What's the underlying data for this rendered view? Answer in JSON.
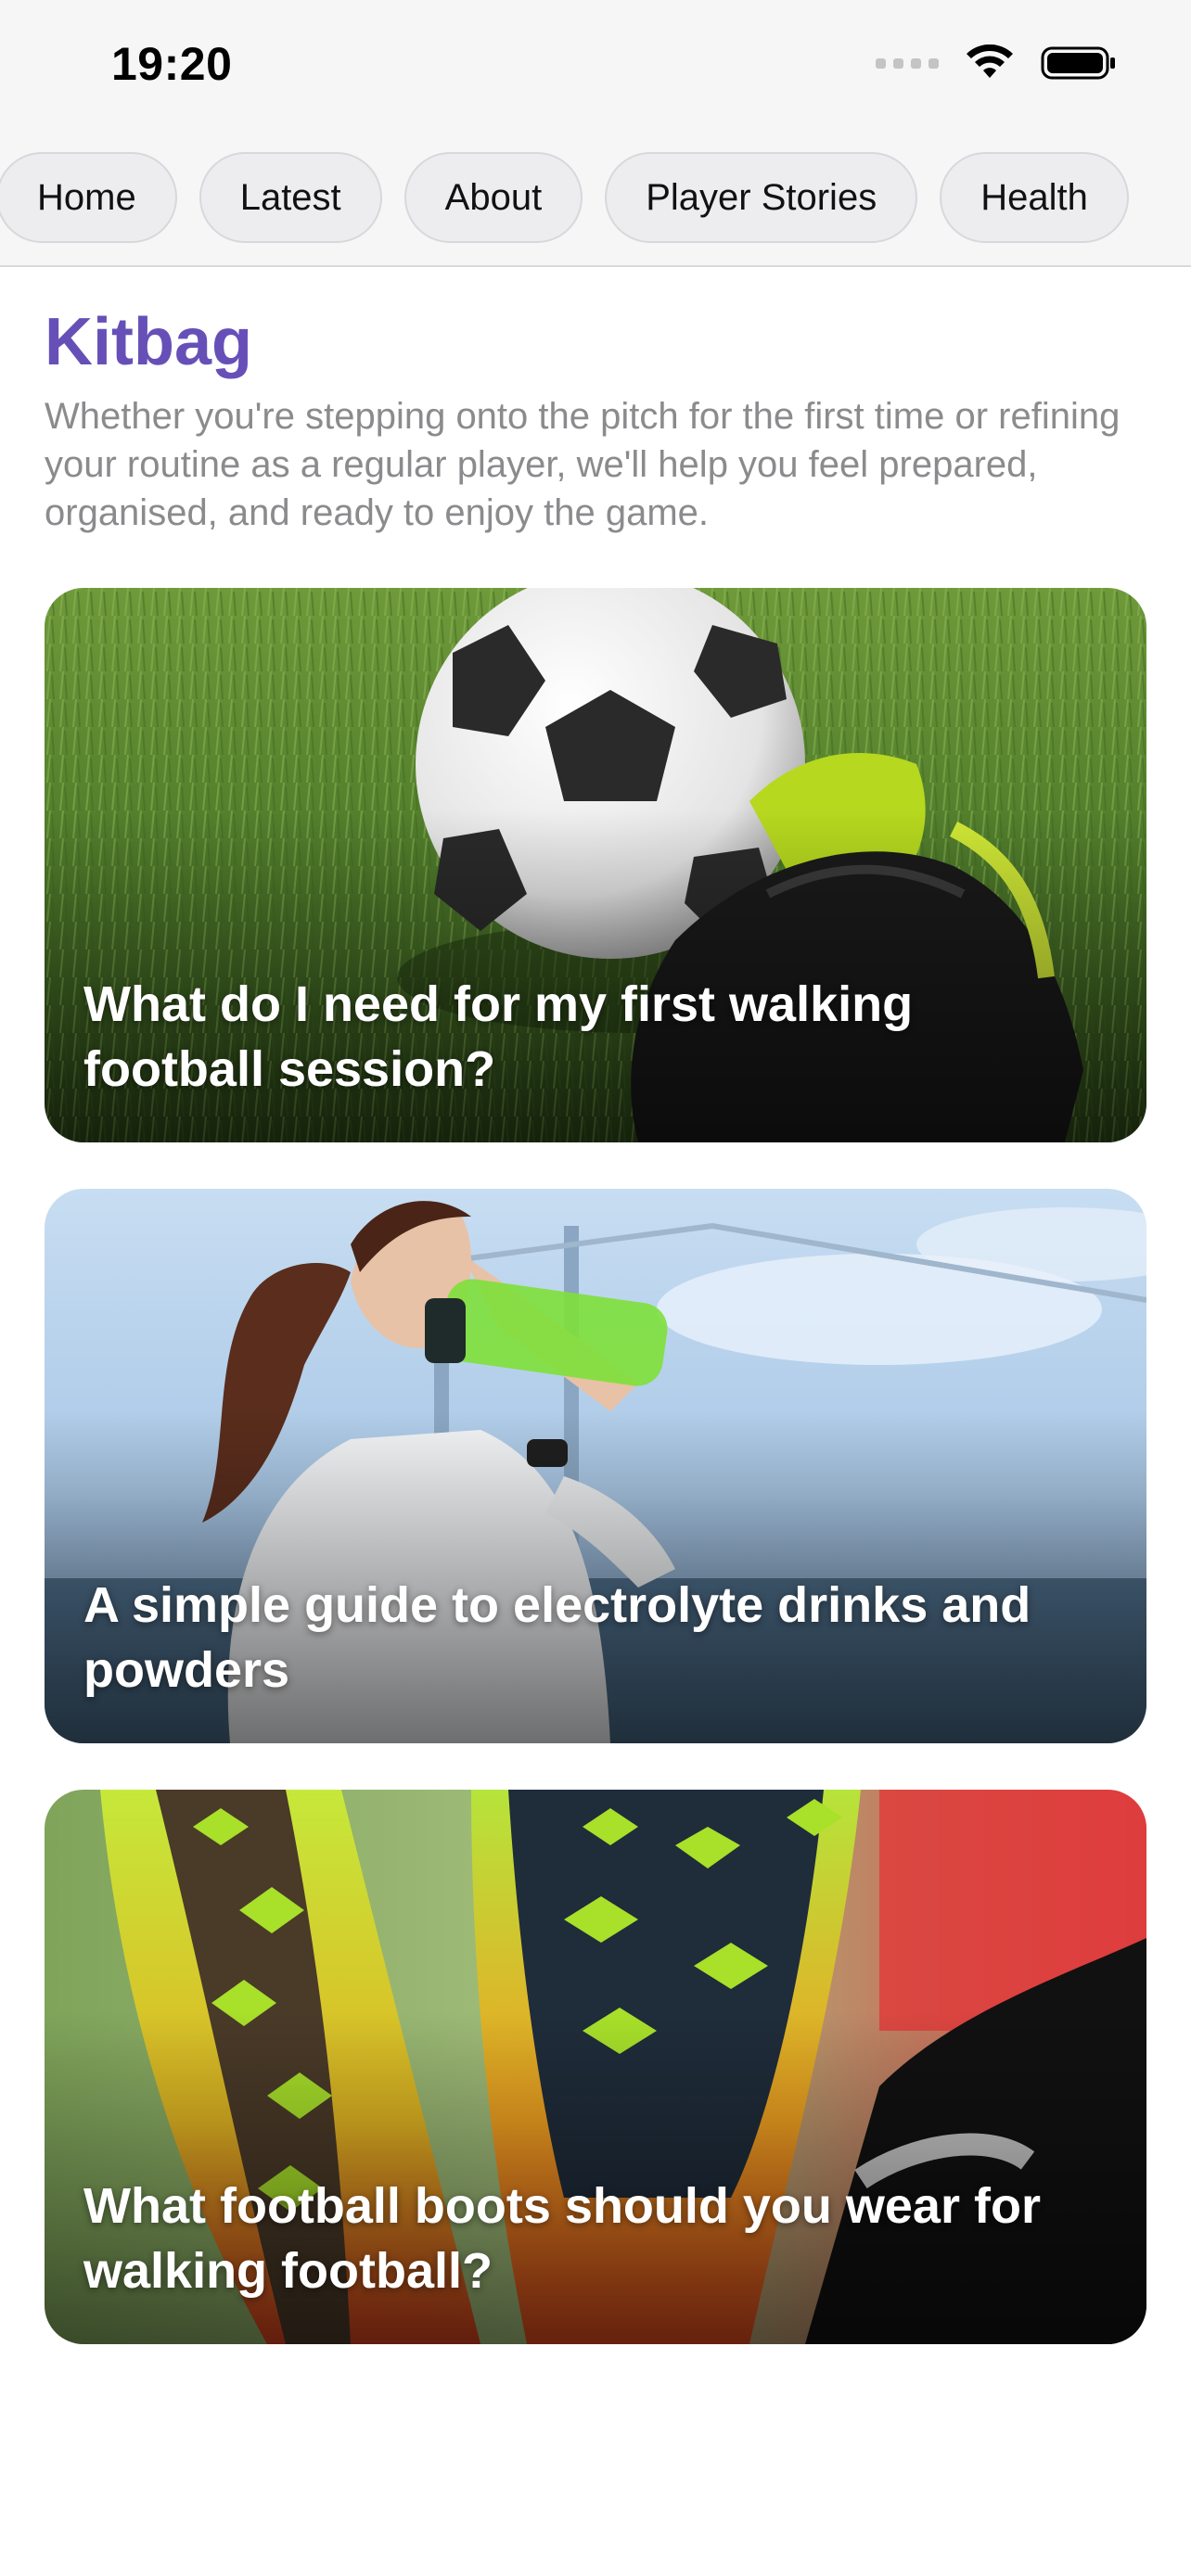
{
  "status_bar": {
    "time": "19:20"
  },
  "nav": {
    "tabs": [
      {
        "label": "Home"
      },
      {
        "label": "Latest"
      },
      {
        "label": "About"
      },
      {
        "label": "Player Stories"
      },
      {
        "label": "Health"
      }
    ]
  },
  "section": {
    "title": "Kitbag",
    "intro": "Whether you're stepping onto the pitch for the first time or refining your routine as a regular player, we'll help you feel prepared, organised, and ready to enjoy the game."
  },
  "articles": [
    {
      "title": "What do I need for my first walking football session?"
    },
    {
      "title": "A simple guide to electrolyte drinks and powders"
    },
    {
      "title": "What football boots should you wear for walking football?"
    }
  ],
  "colors": {
    "accent": "#6650b8",
    "muted_text": "#8b8b8e"
  }
}
